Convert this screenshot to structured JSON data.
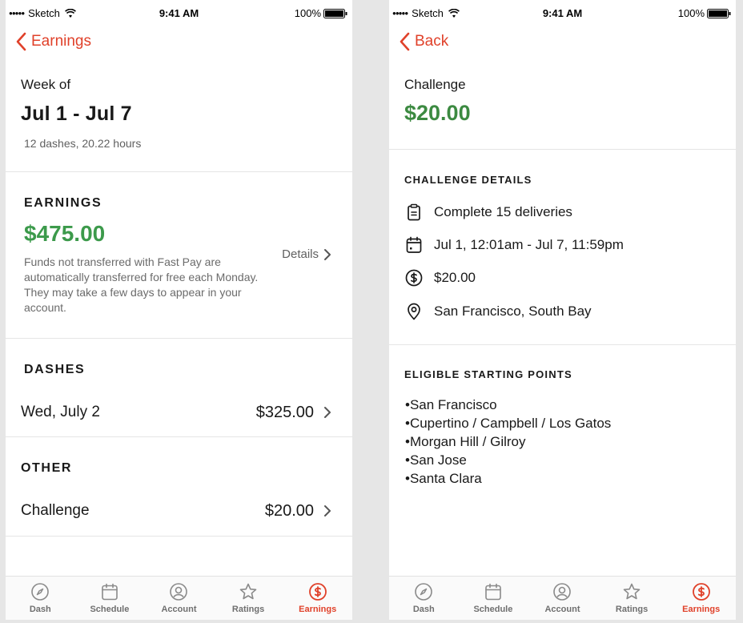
{
  "status_bar": {
    "carrier": "Sketch",
    "time": "9:41 AM",
    "battery": "100%"
  },
  "colors": {
    "accent": "#e0412a",
    "green": "#3c9a4b",
    "tab_inactive": "#8a8a8a"
  },
  "left": {
    "nav_label": "Earnings",
    "week_of": "Week of",
    "week_range": "Jul 1 - Jul 7",
    "week_summary": "12 dashes, 20.22 hours",
    "earnings_heading": "EARNINGS",
    "earnings_amount": "$475.00",
    "funds_note": "Funds not transferred with Fast Pay are automatically transferred for free each Monday. They may take a few days to appear in your account.",
    "details_label": "Details",
    "dashes_heading": "DASHES",
    "dashes_rows": [
      {
        "label": "Wed, July 2",
        "amount": "$325.00"
      }
    ],
    "other_heading": "OTHER",
    "other_rows": [
      {
        "label": "Challenge",
        "amount": "$20.00"
      }
    ]
  },
  "right": {
    "nav_label": "Back",
    "title": "Challenge",
    "amount": "$20.00",
    "details_heading": "CHALLENGE DETAILS",
    "details": [
      {
        "icon": "clipboard-icon",
        "text": "Complete 15 deliveries"
      },
      {
        "icon": "calendar-icon",
        "text": "Jul 1, 12:01am - Jul 7, 11:59pm"
      },
      {
        "icon": "dollar-circle-icon",
        "text": "$20.00"
      },
      {
        "icon": "location-pin-icon",
        "text": "San Francisco, South Bay"
      }
    ],
    "eligible_heading": "ELIGIBLE STARTING POINTS",
    "eligible_points": [
      "San Francisco",
      "Cupertino / Campbell / Los Gatos",
      "Morgan Hill / Gilroy",
      "San Jose",
      "Santa Clara"
    ]
  },
  "tabs": [
    {
      "label": "Dash",
      "icon": "compass-icon",
      "active": false
    },
    {
      "label": "Schedule",
      "icon": "calendar-icon",
      "active": false
    },
    {
      "label": "Account",
      "icon": "user-circle-icon",
      "active": false
    },
    {
      "label": "Ratings",
      "icon": "star-icon",
      "active": false
    },
    {
      "label": "Earnings",
      "icon": "dollar-circle-icon",
      "active": true
    }
  ]
}
